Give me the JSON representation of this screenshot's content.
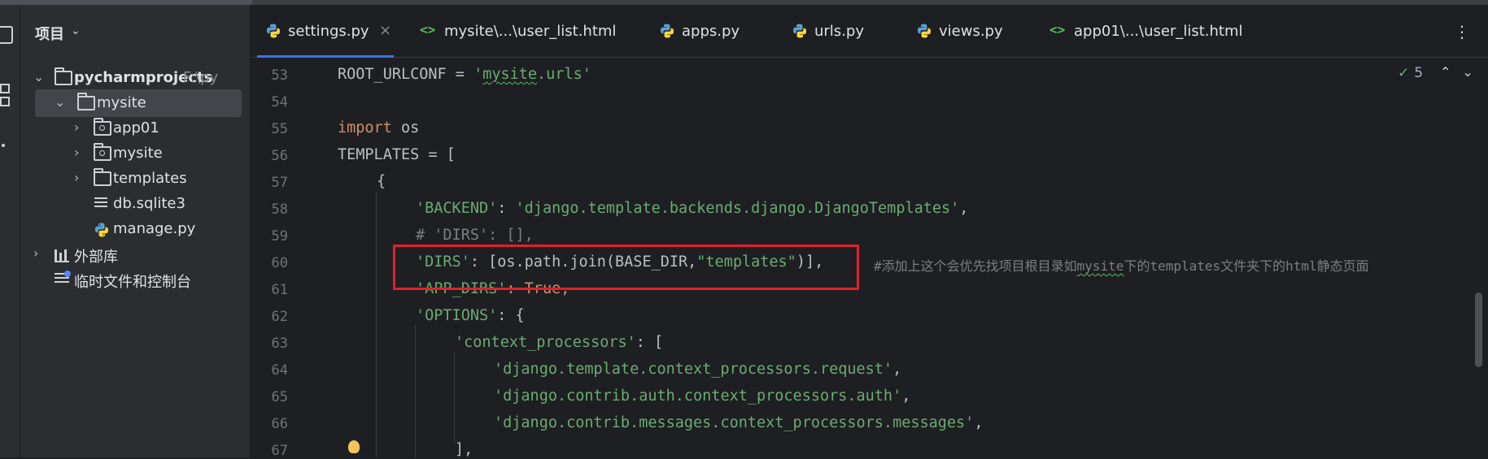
{
  "project_panel": {
    "title": "项目",
    "tree": [
      {
        "label": "pycharmprojects",
        "path": "F:\\py",
        "type": "folder",
        "expanded": true
      },
      {
        "label": "mysite",
        "type": "folder",
        "expanded": true,
        "selected": true
      },
      {
        "label": "app01",
        "type": "package"
      },
      {
        "label": "mysite",
        "type": "package"
      },
      {
        "label": "templates",
        "type": "folder"
      },
      {
        "label": "db.sqlite3",
        "type": "file"
      },
      {
        "label": "manage.py",
        "type": "python"
      },
      {
        "label": "外部库",
        "type": "library"
      },
      {
        "label": "临时文件和控制台",
        "type": "scratches"
      }
    ]
  },
  "tabs": [
    {
      "label": "settings.py",
      "icon": "python-icon",
      "active": true
    },
    {
      "label": "mysite\\...\\user_list.html",
      "icon": "html-icon"
    },
    {
      "label": "apps.py",
      "icon": "python-icon"
    },
    {
      "label": "urls.py",
      "icon": "python-icon"
    },
    {
      "label": "views.py",
      "icon": "python-icon"
    },
    {
      "label": "app01\\...\\user_list.html",
      "icon": "html-icon"
    }
  ],
  "editor": {
    "inspection_count": "5",
    "line_numbers": [
      "53",
      "54",
      "55",
      "56",
      "57",
      "58",
      "59",
      "60",
      "61",
      "62",
      "63",
      "64",
      "65",
      "66",
      "67"
    ],
    "code": {
      "l53_a": "ROOT_URLCONF = ",
      "l53_b": "'",
      "l53_c": "mysite",
      "l53_d": ".urls'",
      "l55_kw": "import",
      "l55_rest": " os",
      "l56": "TEMPLATES = [",
      "l57": "{",
      "l58_a": "'BACKEND'",
      "l58_b": ": ",
      "l58_c": "'django.template.backends.django.DjangoTemplates'",
      "l58_d": ",",
      "l59": "# 'DIRS': [],",
      "l60_a": "'DIRS'",
      "l60_b": ": [os.path.join(BASE_DIR,",
      "l60_c": "\"templates\"",
      "l60_d": ")],",
      "l60_cmt_a": "#添加上这个会优先找项目根目录如",
      "l60_cmt_b": "mysite",
      "l60_cmt_c": "下的templates文件夹下的html静态页面",
      "l61_a": "'APP_DIRS'",
      "l61_b": ": True,",
      "l62_a": "'OPTIONS'",
      "l62_b": ": {",
      "l63_a": "'context_processors'",
      "l63_b": ": [",
      "l64_a": "'django.template.context_processors.request'",
      "l64_b": ",",
      "l65_a": "'django.contrib.auth.context_processors.auth'",
      "l65_b": ",",
      "l66_a": "'django.contrib.messages.context_processors.messages'",
      "l66_b": ",",
      "l67": "],"
    }
  }
}
